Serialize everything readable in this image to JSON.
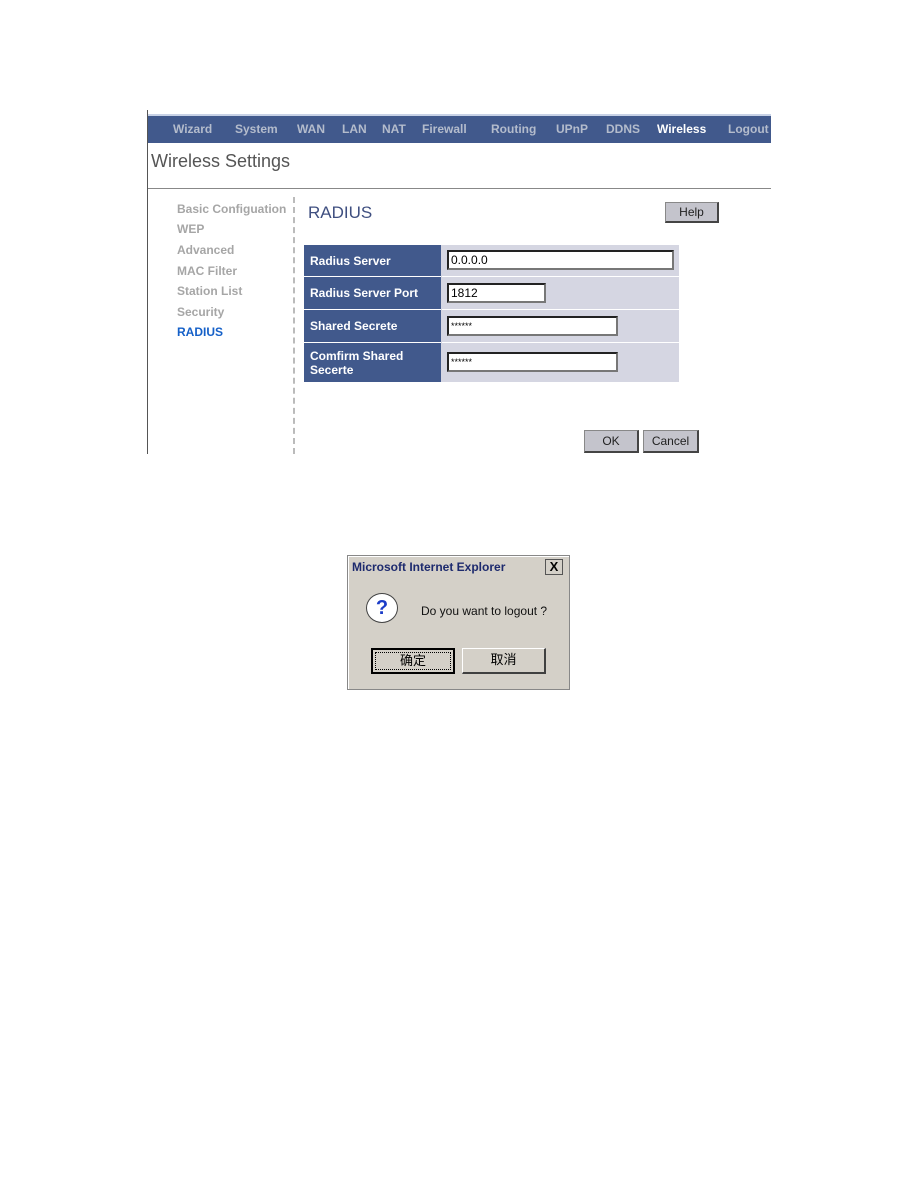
{
  "nav": {
    "items": [
      "Wizard",
      "System",
      "WAN",
      "LAN",
      "NAT",
      "Firewall",
      "Routing",
      "UPnP",
      "DDNS",
      "Wireless",
      "Logout"
    ],
    "active": "Wireless"
  },
  "page_title": "Wireless Settings",
  "sidebar": {
    "items": [
      "Basic Configuation",
      "WEP",
      "Advanced",
      "MAC Filter",
      "Station List",
      "Security",
      "RADIUS"
    ],
    "active": "RADIUS"
  },
  "section_title": "RADIUS",
  "help_label": "Help",
  "form": {
    "rows": [
      {
        "label": "Radius Server",
        "value": "0.0.0.0"
      },
      {
        "label": "Radius Server Port",
        "value": "1812"
      },
      {
        "label": "Shared Secrete",
        "value": "******"
      },
      {
        "label": "Comfirm Shared Secerte",
        "value": "******"
      }
    ]
  },
  "ok_label": "OK",
  "cancel_label": "Cancel",
  "dialog": {
    "title": "Microsoft Internet Explorer",
    "close": "X",
    "icon": "question-icon",
    "message": "Do you want to logout ?",
    "ok_label": "确定",
    "cancel_label": "取消"
  },
  "colors": {
    "nav_bg": "#41598c",
    "active_link": "#1560c8"
  }
}
